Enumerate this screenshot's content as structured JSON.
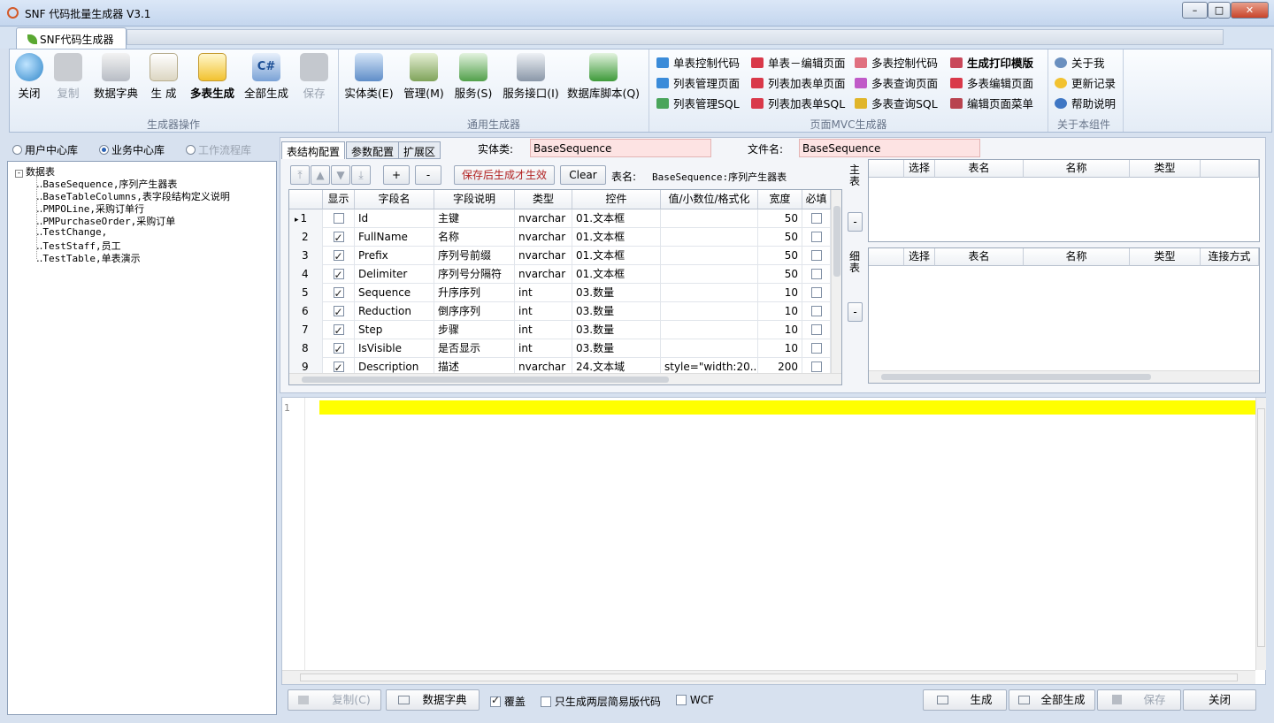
{
  "window": {
    "title": "SNF 代码批量生成器 V3.1"
  },
  "app_tab": "SNF代码生成器",
  "ribbon": {
    "group1": {
      "label": "生成器操作",
      "buttons": [
        "关闭",
        "复制",
        "数据字典",
        "生 成",
        "多表生成",
        "全部生成",
        "保存"
      ]
    },
    "group2": {
      "label": "通用生成器",
      "buttons": [
        "实体类(E)",
        "管理(M)",
        "服务(S)",
        "服务接口(I)",
        "数据库脚本(Q)"
      ]
    },
    "group3": {
      "label": "页面MVC生成器",
      "items": [
        "单表控制代码",
        "列表管理页面",
        "列表管理SQL",
        "单表－编辑页面",
        "列表加表单页面",
        "列表加表单SQL",
        "多表控制代码",
        "多表查询页面",
        "多表查询SQL",
        "生成打印模版",
        "多表编辑页面",
        "编辑页面菜单"
      ]
    },
    "group4": {
      "label": "关于本组件",
      "items": [
        "关于我",
        "更新记录",
        "帮助说明"
      ]
    }
  },
  "db_radios": [
    "用户中心库",
    "业务中心库",
    "工作流程库"
  ],
  "tree": {
    "root": "数据表",
    "items": [
      "BaseSequence,序列产生器表",
      "BaseTableColumns,表字段结构定义说明",
      "PMPOLine,采购订单行",
      "PMPurchaseOrder,采购订单",
      "TestChange,",
      "TestStaff,员工",
      "TestTable,单表演示"
    ]
  },
  "subtabs": [
    "表结构配置",
    "参数配置",
    "扩展区"
  ],
  "entity_label": "实体类:",
  "entity_value": "BaseSequence",
  "file_label": "文件名:",
  "file_value": "BaseSequence",
  "toolbar": {
    "plus": "+",
    "minus": "-",
    "save_note": "保存后生成才生效",
    "clear": "Clear",
    "table_label": "表名:",
    "table_value": "BaseSequence:序列产生器表"
  },
  "grid": {
    "headers": [
      "显示",
      "字段名",
      "字段说明",
      "类型",
      "控件",
      "值/小数位/格式化",
      "宽度",
      "必填"
    ],
    "rows": [
      {
        "num": "1",
        "show": false,
        "name": "Id",
        "desc": "主键",
        "type": "nvarchar",
        "ctrl": "01.文本框",
        "fmt": "",
        "width": "50"
      },
      {
        "num": "2",
        "show": true,
        "name": "FullName",
        "desc": "名称",
        "type": "nvarchar",
        "ctrl": "01.文本框",
        "fmt": "",
        "width": "50"
      },
      {
        "num": "3",
        "show": true,
        "name": "Prefix",
        "desc": "序列号前缀",
        "type": "nvarchar",
        "ctrl": "01.文本框",
        "fmt": "",
        "width": "50"
      },
      {
        "num": "4",
        "show": true,
        "name": "Delimiter",
        "desc": "序列号分隔符",
        "type": "nvarchar",
        "ctrl": "01.文本框",
        "fmt": "",
        "width": "50"
      },
      {
        "num": "5",
        "show": true,
        "name": "Sequence",
        "desc": "升序序列",
        "type": "int",
        "ctrl": "03.数量",
        "fmt": "",
        "width": "10"
      },
      {
        "num": "6",
        "show": true,
        "name": "Reduction",
        "desc": "倒序序列",
        "type": "int",
        "ctrl": "03.数量",
        "fmt": "",
        "width": "10"
      },
      {
        "num": "7",
        "show": true,
        "name": "Step",
        "desc": "步骤",
        "type": "int",
        "ctrl": "03.数量",
        "fmt": "",
        "width": "10"
      },
      {
        "num": "8",
        "show": true,
        "name": "IsVisible",
        "desc": "是否显示",
        "type": "int",
        "ctrl": "03.数量",
        "fmt": "",
        "width": "10"
      },
      {
        "num": "9",
        "show": true,
        "name": "Description",
        "desc": "描述",
        "type": "nvarchar",
        "ctrl": "24.文本域",
        "fmt": "style=\"width:20...",
        "width": "200"
      }
    ]
  },
  "main_table": {
    "side_label": "主表",
    "btn": "-",
    "headers": [
      "选择",
      "表名",
      "名称",
      "类型"
    ]
  },
  "detail_table": {
    "side_label": "细表",
    "btn": "-",
    "headers": [
      "选择",
      "表名",
      "名称",
      "类型",
      "连接方式"
    ]
  },
  "editor": {
    "line_number": "1"
  },
  "bottom": {
    "copy": "复制(C)",
    "dict": "数据字典",
    "overwrite": "覆盖",
    "two_layer": "只生成两层简易版代码",
    "wcf": "WCF",
    "gen": "生成",
    "gen_all": "全部生成",
    "save": "保存",
    "close": "关闭"
  },
  "colors": {
    "highlight": "#ffff00",
    "entity_bg": "#fde3e3",
    "ribbon_bg": "#e4ecf6"
  }
}
